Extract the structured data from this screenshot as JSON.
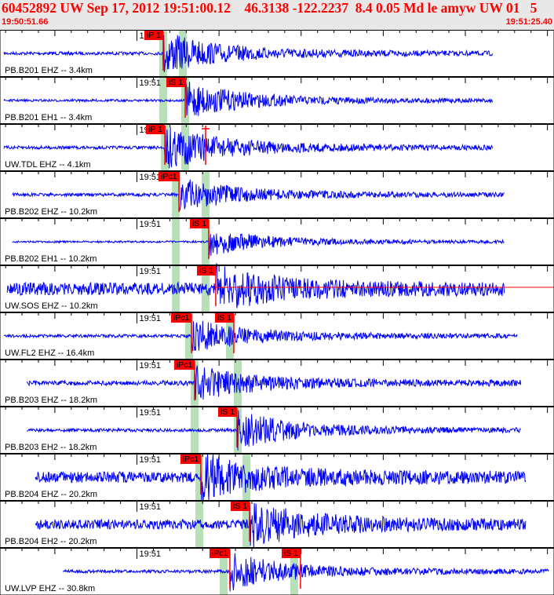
{
  "header": {
    "title": "60452892 UW Sep 17, 2012 19:51:00.12    46.3138 -122.2237  8.4 0.05 Md le amyw UW 01   5",
    "start_time": "19:50:51.66",
    "end_time": "19:51:25.40",
    "minute_label": "19:51"
  },
  "colors": {
    "trace": "#0000ff",
    "pick": "#ff0000",
    "predicted": "#b8e0b8",
    "header_bg": "#e8e8e8"
  },
  "traces": [
    {
      "label": "PB.B201 EHZ -- 3.4km",
      "picks": [
        {
          "phase": "iP 1",
          "time": "19:51:01.60"
        }
      ],
      "predicted": [
        "19:51:01.60",
        "19:51:02.80"
      ],
      "span": [
        "19:50:51.90",
        "19:51:21.70"
      ],
      "noise": 2,
      "amp": 22
    },
    {
      "label": "PB.B201 EH1 -- 3.4km",
      "picks": [
        {
          "phase": "iS 1",
          "time": "19:51:02.94"
        }
      ],
      "predicted": [
        "19:51:01.60",
        "19:51:02.94"
      ],
      "span": [
        "19:50:51.90",
        "19:51:21.70"
      ],
      "noise": 1.5,
      "amp": 20
    },
    {
      "label": "UW.TDL EHZ -- 4.1km",
      "picks": [
        {
          "phase": "iP 1",
          "time": "19:51:01.70"
        },
        {
          "phase": "",
          "time": "19:51:04.18"
        }
      ],
      "predicted": [
        "19:51:01.70",
        "19:51:02.94"
      ],
      "span": [
        "19:50:51.90",
        "19:51:21.70"
      ],
      "noise": 2,
      "amp": 24
    },
    {
      "label": "PB.B202 EHZ -- 10.2km",
      "picks": [
        {
          "phase": "iPc1",
          "time": "19:51:02.56"
        }
      ],
      "predicted": [
        "19:51:02.37",
        "19:51:04.18"
      ],
      "span": [
        "19:50:52.40",
        "19:51:22.40"
      ],
      "noise": 2,
      "amp": 18
    },
    {
      "label": "PB.B202 EH1 -- 10.2km",
      "picks": [
        {
          "phase": "iS 1",
          "time": "19:51:04.37"
        }
      ],
      "predicted": [
        "19:51:02.37",
        "19:51:04.18"
      ],
      "span": [
        "19:50:52.40",
        "19:51:22.40"
      ],
      "noise": 1.2,
      "amp": 14
    },
    {
      "label": "UW.SOS EHZ -- 10.2km",
      "picks": [
        {
          "phase": "iS 1",
          "time": "19:51:04.80"
        }
      ],
      "predicted": [
        "19:51:02.37",
        "19:51:04.18"
      ],
      "span": [
        "19:50:52.10",
        "19:51:22.40"
      ],
      "noise": 8,
      "amp": 20
    },
    {
      "label": "UW.FL2 EHZ -- 16.4km",
      "picks": [
        {
          "phase": "iPc1",
          "time": "19:51:03.32"
        },
        {
          "phase": "iS 1",
          "time": "19:51:05.90"
        }
      ],
      "predicted": [
        "19:51:03.18",
        "19:51:05.66"
      ],
      "span": [
        "19:50:51.90",
        "19:51:23.20"
      ],
      "noise": 2,
      "amp": 18
    },
    {
      "label": "PB.B203 EHZ -- 18.2km",
      "picks": [
        {
          "phase": "iPc1",
          "time": "19:51:03.51"
        }
      ],
      "predicted": [
        "19:51:03.51",
        "19:51:06.14"
      ],
      "span": [
        "19:50:53.30",
        "19:51:23.40"
      ],
      "noise": 3,
      "amp": 18
    },
    {
      "label": "PB.B203 EH2 -- 18.2km",
      "picks": [
        {
          "phase": "iS 1",
          "time": "19:51:06.09"
        }
      ],
      "predicted": [
        "19:51:03.51",
        "19:51:06.14"
      ],
      "span": [
        "19:50:53.30",
        "19:51:23.40"
      ],
      "noise": 2,
      "amp": 20
    },
    {
      "label": "PB.B204 EHZ -- 20.2km",
      "picks": [
        {
          "phase": "iPc1",
          "time": "19:51:03.89"
        }
      ],
      "predicted": [
        "19:51:03.80",
        "19:51:06.67"
      ],
      "span": [
        "19:50:53.80",
        "19:51:23.70"
      ],
      "noise": 7,
      "amp": 22
    },
    {
      "label": "PB.B204 EH2 -- 20.2km",
      "picks": [
        {
          "phase": "iS 1",
          "time": "19:51:06.86"
        }
      ],
      "predicted": [
        "19:51:03.80",
        "19:51:06.67"
      ],
      "span": [
        "19:50:53.80",
        "19:51:23.70"
      ],
      "noise": 6,
      "amp": 22
    },
    {
      "label": "UW.LVP EHZ -- 30.8km",
      "picks": [
        {
          "phase": "iPc1",
          "time": "19:51:05.66"
        },
        {
          "phase": "iS 1",
          "time": "19:51:09.96"
        }
      ],
      "predicted": [
        "19:51:05.28",
        "19:51:09.58"
      ],
      "span": [
        "19:50:55.50",
        "19:51:25.10"
      ],
      "noise": 2,
      "amp": 20
    }
  ]
}
